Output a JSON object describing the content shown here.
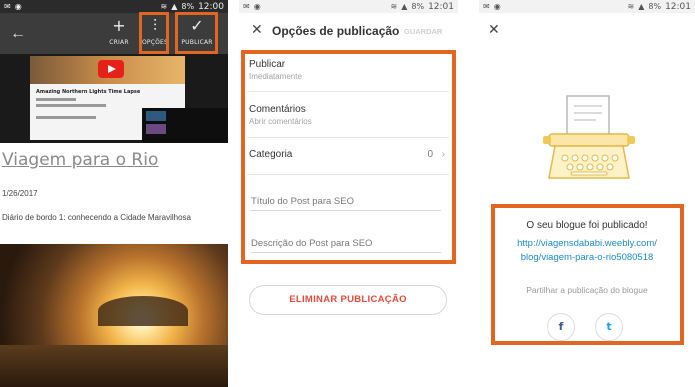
{
  "status_bars": {
    "left": {
      "battery": "8%",
      "time": "12:00"
    },
    "middle": {
      "battery": "8%",
      "time": "12:01"
    },
    "right": {
      "battery": "8%",
      "time": "12:01"
    }
  },
  "editor": {
    "toolbar": {
      "back_icon": "arrow-left-icon",
      "criar_label": "CRIAR",
      "opcoes_label": "OPÇÕES",
      "publicar_label": "PUBLICAR"
    },
    "video_title": "Amazing Northern Lights Time Lapse",
    "post_title": "Viagem para o Rio",
    "post_date": "1/26/2017",
    "post_snippet": "Diário de bordo 1: conhecendo a Cidade Maravilhosa"
  },
  "options": {
    "title": "Opções de publicação",
    "save_label": "GUARDAR",
    "publish": {
      "label": "Publicar",
      "value": "Imediatamente"
    },
    "comments": {
      "label": "Comentários",
      "value": "Abrir comentários"
    },
    "category": {
      "label": "Categoria",
      "count": "0"
    },
    "seo_title_placeholder": "Título do Post para SEO",
    "seo_description_placeholder": "Descrição do Post para SEO",
    "delete_label": "ELIMINAR PUBLICAÇÃO"
  },
  "published": {
    "message": "O seu blogue foi publicado!",
    "link_line1": "http://viagensdababi.weebly.com/",
    "link_line2": "blog/viagem-para-o-rio5080518",
    "share_label": "Partilhar a publicação do blogue",
    "facebook_glyph": "f",
    "twitter_glyph": "t"
  },
  "colors": {
    "highlight": "#e2661f",
    "danger": "#e24a3b",
    "link": "#1e88c9",
    "illustration": "#f1c85a"
  }
}
